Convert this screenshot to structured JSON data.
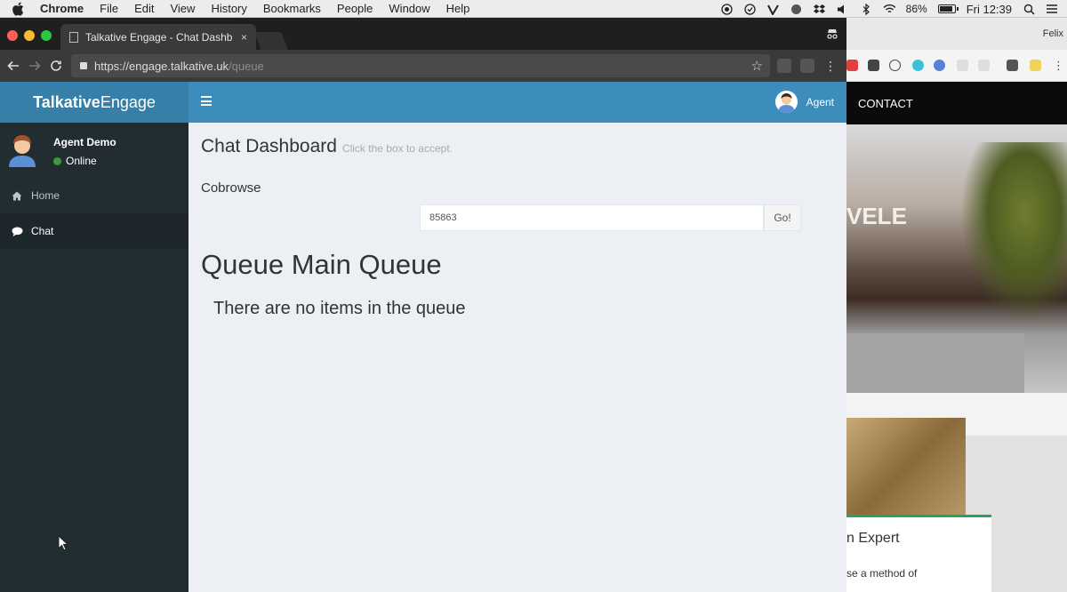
{
  "menubar": {
    "app_name": "Chrome",
    "items": [
      "File",
      "Edit",
      "View",
      "History",
      "Bookmarks",
      "People",
      "Window",
      "Help"
    ],
    "battery": "86%",
    "clock": "Fri 12:39"
  },
  "browser": {
    "tab_title": "Talkative Engage - Chat Dashb",
    "url_host": "https://engage.talkative.uk",
    "url_path": "/queue"
  },
  "app": {
    "logo_bold": "Talkative",
    "logo_light": "Engage",
    "user_name": "Agent Demo",
    "user_status": "Online",
    "header_user": "Agent",
    "nav": [
      {
        "label": "Home",
        "icon": "home-icon"
      },
      {
        "label": "Chat",
        "icon": "chat-icon"
      }
    ]
  },
  "content": {
    "page_title": "Chat Dashboard",
    "page_subtitle": "Click the box to accept.",
    "cobrowse_label": "Cobrowse",
    "cobrowse_value": "85863",
    "go_label": "Go!",
    "queue_title": "Queue Main Queue",
    "queue_empty": "There are no items in the queue"
  },
  "background_window": {
    "title": "Felix",
    "nav_item": "CONTACT",
    "hero_text": "VELE",
    "card_heading": "n Expert",
    "card_text": "se a method of"
  },
  "colors": {
    "brand_dark": "#367fa9",
    "brand": "#3c8dbc",
    "sidebar": "#222d32",
    "content_bg": "#ecf0f5"
  }
}
